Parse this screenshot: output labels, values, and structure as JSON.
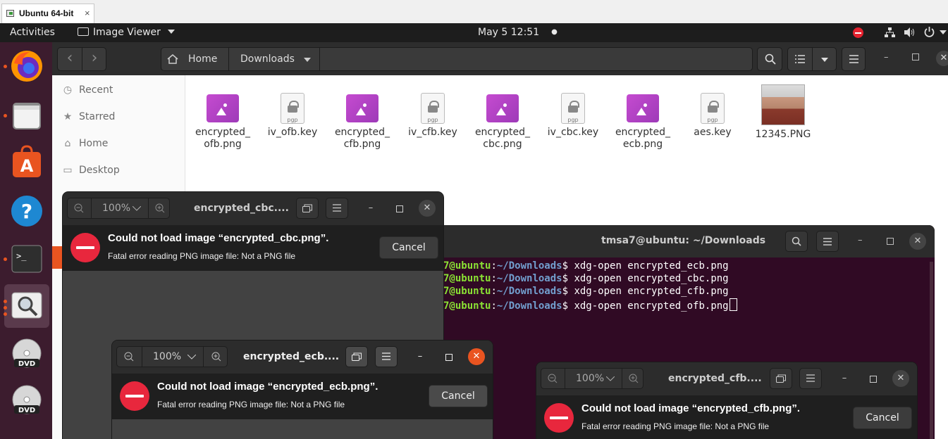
{
  "vm": {
    "tab_title": "Ubuntu 64-bit",
    "close": "×"
  },
  "topbar": {
    "activities": "Activities",
    "app_menu": "Image Viewer",
    "clock": "May 5  12:51",
    "dot": "●"
  },
  "dock": {
    "items": [
      "firefox",
      "files",
      "app-center",
      "help",
      "terminal",
      "image-viewer",
      "dvd",
      "dvd"
    ]
  },
  "files": {
    "back": "‹",
    "forward": "›",
    "path": [
      "Home",
      "Downloads"
    ],
    "sidebar": [
      {
        "label": "Recent",
        "icon": "clock-icon"
      },
      {
        "label": "Starred",
        "icon": "star-icon"
      },
      {
        "label": "Home",
        "icon": "home-icon"
      },
      {
        "label": "Desktop",
        "icon": "desktop-icon"
      }
    ],
    "items": [
      {
        "name1": "encrypted_",
        "name2": "ofb.png",
        "type": "image"
      },
      {
        "name1": "iv_ofb.key",
        "name2": "",
        "type": "key"
      },
      {
        "name1": "encrypted_",
        "name2": "cfb.png",
        "type": "image"
      },
      {
        "name1": "iv_cfb.key",
        "name2": "",
        "type": "key"
      },
      {
        "name1": "encrypted_",
        "name2": "cbc.png",
        "type": "image"
      },
      {
        "name1": "iv_cbc.key",
        "name2": "",
        "type": "key"
      },
      {
        "name1": "encrypted_",
        "name2": "ecb.png",
        "type": "image"
      },
      {
        "name1": "aes.key",
        "name2": "",
        "type": "key"
      },
      {
        "name1": "12345.PNG",
        "name2": "",
        "type": "photo"
      }
    ],
    "pgp": "pgp"
  },
  "terminal": {
    "title": "tmsa7@ubuntu: ~/Downloads",
    "user": "7@ubuntu",
    "path": "~/Downloads",
    "lines": [
      "xdg-open encrypted_ecb.png",
      "xdg-open encrypted_cbc.png",
      "xdg-open encrypted_cfb.png",
      "xdg-open encrypted_ofb.png"
    ]
  },
  "viewers": [
    {
      "title": "encrypted_cbc....",
      "zoom": "100%",
      "error": "Could not load image “encrypted_cbc.png”.",
      "detail": "Fatal error reading PNG image file: Not a PNG file",
      "cancel": "Cancel"
    },
    {
      "title": "encrypted_ecb....",
      "zoom": "100%",
      "error": "Could not load image “encrypted_ecb.png”.",
      "detail": "Fatal error reading PNG image file: Not a PNG file",
      "cancel": "Cancel"
    },
    {
      "title": "encrypted_cfb....",
      "zoom": "100%",
      "error": "Could not load image “encrypted_cfb.png”.",
      "detail": "Fatal error reading PNG image file: Not a PNG file",
      "cancel": "Cancel"
    }
  ],
  "colors": {
    "ubuntu_orange": "#e95420",
    "error_red": "#e8273d",
    "terminal_bg": "#300a24",
    "prompt_green": "#8ae234",
    "path_blue": "#729fcf"
  }
}
